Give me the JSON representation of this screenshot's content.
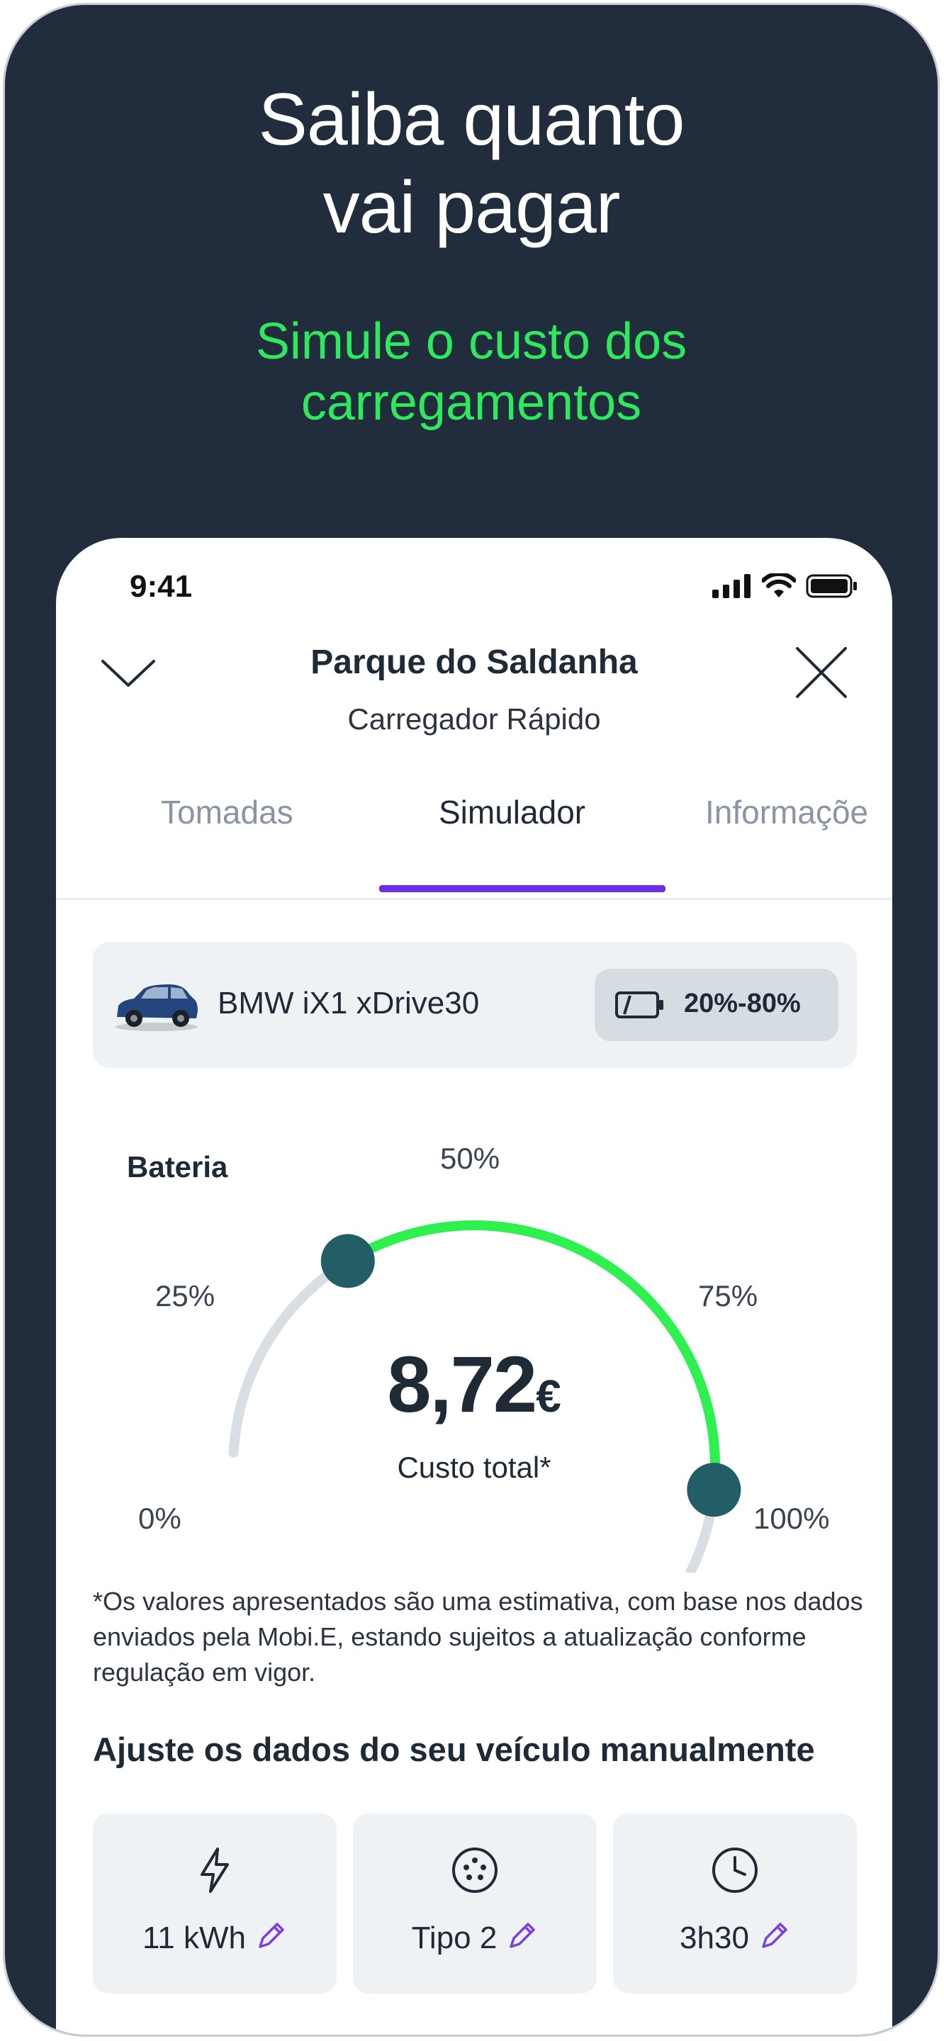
{
  "promo": {
    "headline_line1": "Saiba quanto",
    "headline_line2": "vai pagar",
    "subheadline_line1": "Simule o custo dos",
    "subheadline_line2": "carregamentos",
    "accent_color": "#2ee85d",
    "background_color": "#212d3c"
  },
  "status_bar": {
    "time": "9:41",
    "icons": [
      "signal-icon",
      "wifi-icon",
      "battery-icon"
    ]
  },
  "header": {
    "station_name": "Parque do Saldanha",
    "charger_type": "Carregador Rápido",
    "left_icon": "chevron-down-icon",
    "right_icon": "close-icon"
  },
  "tabs": [
    {
      "label": "Tomadas",
      "active": false
    },
    {
      "label": "Simulador",
      "active": true
    },
    {
      "label": "Informaçõe",
      "active": false
    }
  ],
  "tab_accent_color": "#6b2fe8",
  "vehicle": {
    "name": "BMW iX1 xDrive30",
    "battery_range": "20%-80%",
    "battery_icon": "battery-outline-icon"
  },
  "gauge": {
    "label": "Bateria",
    "ticks": {
      "t0": "0%",
      "t25": "25%",
      "t50": "50%",
      "t75": "75%",
      "t100": "100%"
    },
    "range_start_pct": 20,
    "range_end_pct": 80,
    "arc_color": "#2ef04f",
    "handle_color": "#235e66"
  },
  "cost": {
    "value": "8,72",
    "currency": "€",
    "label": "Custo total*"
  },
  "disclaimer": "*Os valores apresentados são uma estimativa, com base nos dados enviados pela Mobi.E, estando sujeitos a atualização conforme regulação em vigor.",
  "manual": {
    "title": "Ajuste os dados do seu veículo manualmente",
    "params": [
      {
        "icon": "lightning-icon",
        "value": "11 kWh"
      },
      {
        "icon": "connector-type2-icon",
        "value": "Tipo 2"
      },
      {
        "icon": "clock-icon",
        "value": "3h30"
      }
    ],
    "edit_icon": "pencil-icon"
  }
}
